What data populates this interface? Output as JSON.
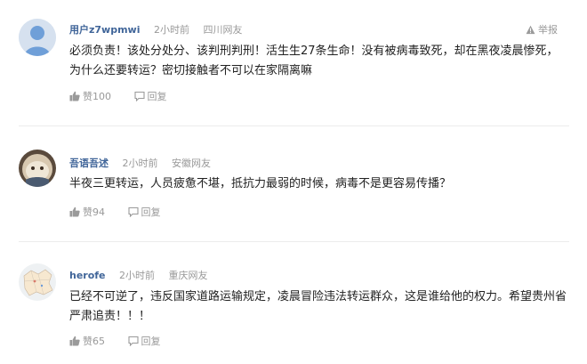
{
  "report_label": "举报",
  "reply_label": "回复",
  "comments": [
    {
      "user": "用户z7wpmwi",
      "time": "2小时前",
      "location": "四川网友",
      "text": "必须负责！该处分处分、该判刑判刑！活生生27条生命！没有被病毒致死，却在黑夜凌晨惨死，为什么还要转运？密切接触者不可以在家隔离嘛",
      "likes": "赞100",
      "avatar": "default-user-avatar"
    },
    {
      "user": "吾语吾述",
      "time": "2小时前",
      "location": "安徽网友",
      "text": "半夜三更转运，人员疲惫不堪，抵抗力最弱的时候，病毒不是更容易传播？",
      "likes": "赞94",
      "avatar": "photo-avatar"
    },
    {
      "user": "herofe",
      "time": "2小时前",
      "location": "重庆网友",
      "text": "已经不可逆了，违反国家道路运输规定，凌晨冒险违法转运群众，这是谁给他的权力。希望贵州省严肃追责！！！",
      "likes": "赞65",
      "avatar": "map-avatar"
    }
  ],
  "colors": {
    "username": "#406599",
    "muted": "#999999",
    "text": "#222222",
    "divider": "#ececec"
  },
  "icons": [
    "warning-icon",
    "thumbs-up-icon",
    "comment-icon"
  ]
}
